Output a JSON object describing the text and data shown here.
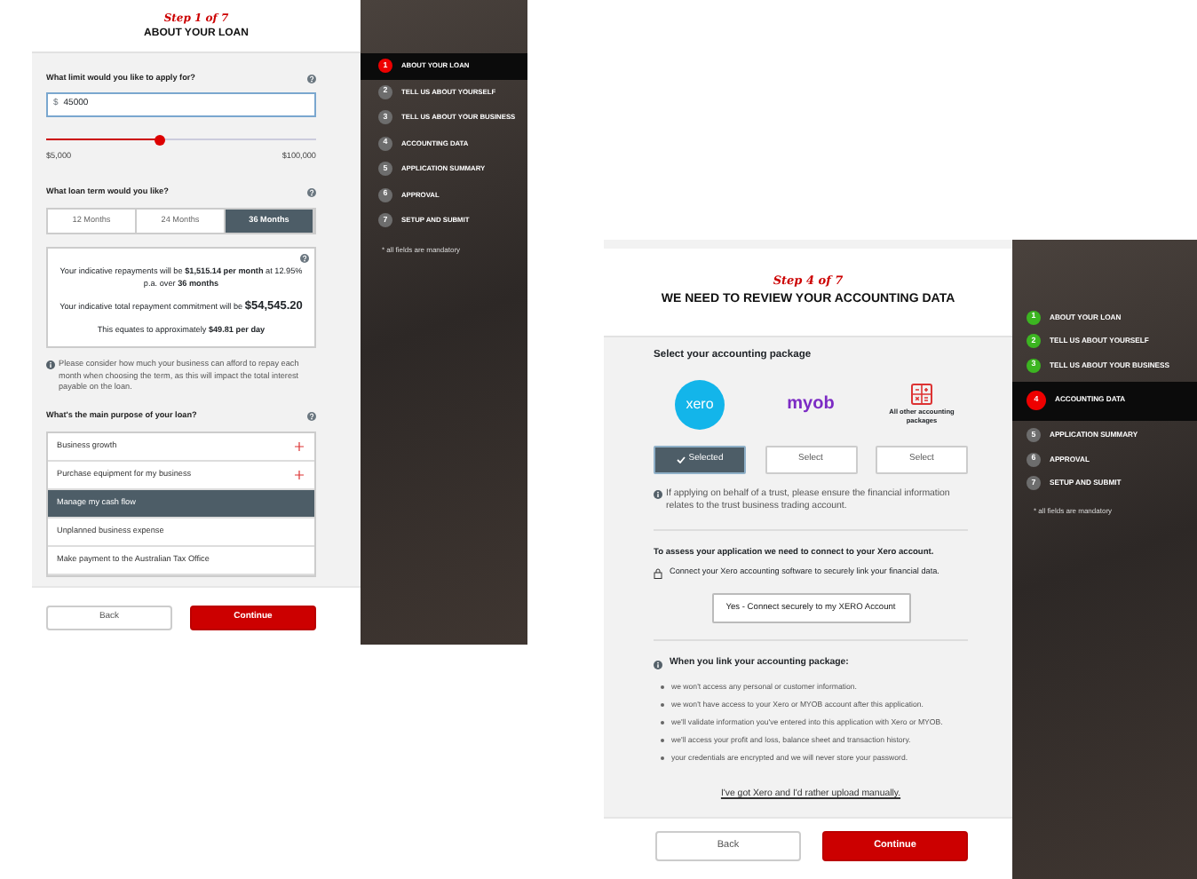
{
  "loan_screen": {
    "step_label": "Step 1 of 7",
    "title": "ABOUT YOUR LOAN",
    "limit_question": "What limit would you like to apply for?",
    "limit_field": {
      "prefix": "$",
      "value": "45000"
    },
    "limit_slider": {
      "level": 0.42,
      "min_label": "$5,000",
      "max_label": "$100,000"
    },
    "term_question": "What loan term would you like?",
    "term_tabs": [
      {
        "label": "12 Months",
        "selected": false
      },
      {
        "label": "24 Months",
        "selected": false
      },
      {
        "label": "36 Months",
        "selected": true
      }
    ],
    "summary": {
      "repayment": "Your indicative repayments will be **$1,515.14 per month** at 12.95% p.a. over **36 months**",
      "total": "Your indicative total repayment commitment will be **$54,545.20**",
      "daily": "This equates to approximately **$49.81 per day**"
    },
    "term_note": "Please consider how much your business can afford to repay each month when choosing the term, as this will impact the total interest payable on the loan.",
    "purpose_question": "What's the main purpose of your loan?",
    "purposes": [
      {
        "label": "Business growth",
        "expandable": true,
        "selected": false
      },
      {
        "label": "Purchase equipment for my business",
        "expandable": true,
        "selected": false
      },
      {
        "label": "Manage my cash flow",
        "expandable": false,
        "selected": true
      },
      {
        "label": "Unplanned business expense",
        "expandable": false,
        "selected": false
      },
      {
        "label": "Make payment to the Australian Tax Office",
        "expandable": false,
        "selected": false
      }
    ],
    "buttons": {
      "back": "Back",
      "continue": "Continue"
    },
    "steps": [
      {
        "number": "1",
        "label": "ABOUT YOUR LOAN",
        "completed": false,
        "current": true
      },
      {
        "number": "2",
        "label": "TELL US ABOUT YOURSELF",
        "completed": false,
        "current": false
      },
      {
        "number": "3",
        "label": "TELL US ABOUT YOUR BUSINESS",
        "completed": false,
        "current": false
      },
      {
        "number": "4",
        "label": "ACCOUNTING DATA",
        "completed": false,
        "current": false
      },
      {
        "number": "5",
        "label": "APPLICATION SUMMARY",
        "completed": false,
        "current": false
      },
      {
        "number": "6",
        "label": "APPROVAL",
        "completed": false,
        "current": false
      },
      {
        "number": "7",
        "label": "SETUP AND SUBMIT",
        "completed": false,
        "current": false
      }
    ],
    "mandatory_note": "* all fields are mandatory"
  },
  "accounting_screen": {
    "step_label": "Step 4 of 7",
    "title": "WE NEED TO REVIEW YOUR ACCOUNTING DATA",
    "package_heading": "Select your accounting package",
    "packages": [
      {
        "kind": "xero",
        "logo_text": "xero",
        "button": "Selected",
        "selected": true
      },
      {
        "kind": "myob",
        "logo_text": "myob",
        "button": "Select",
        "selected": false
      },
      {
        "kind": "other",
        "caption": "All other accounting packages",
        "button": "Select",
        "selected": false
      }
    ],
    "trust_note": "If applying on behalf of a trust, please ensure the financial information relates to the trust business trading account.",
    "connect_heading": "To assess your application we need to connect to your Xero account.",
    "connect_note": "Connect your Xero accounting software to securely link your financial data.",
    "connect_button": "Yes - Connect securely to my XERO Account",
    "link_heading": "When you link your accounting package:",
    "link_points": [
      "we won't access any personal or customer information.",
      "we won't have access to your Xero or MYOB account after this application.",
      "we'll validate information you've entered into this application with Xero or MYOB.",
      "we'll access your profit and loss, balance sheet and transaction history.",
      "your credentials are encrypted and we will never store your password."
    ],
    "manual_link": "I've got Xero and I'd rather upload manually.",
    "buttons": {
      "back": "Back",
      "continue": "Continue"
    },
    "steps": [
      {
        "number": "1",
        "label": "ABOUT YOUR LOAN",
        "completed": true,
        "current": false
      },
      {
        "number": "2",
        "label": "TELL US ABOUT YOURSELF",
        "completed": true,
        "current": false
      },
      {
        "number": "3",
        "label": "TELL US ABOUT YOUR BUSINESS",
        "completed": true,
        "current": false
      },
      {
        "number": "4",
        "label": "ACCOUNTING DATA",
        "completed": false,
        "current": true
      },
      {
        "number": "5",
        "label": "APPLICATION SUMMARY",
        "completed": false,
        "current": false
      },
      {
        "number": "6",
        "label": "APPROVAL",
        "completed": false,
        "current": false
      },
      {
        "number": "7",
        "label": "SETUP AND SUBMIT",
        "completed": false,
        "current": false
      }
    ],
    "mandatory_note": "* all fields are mandatory"
  }
}
